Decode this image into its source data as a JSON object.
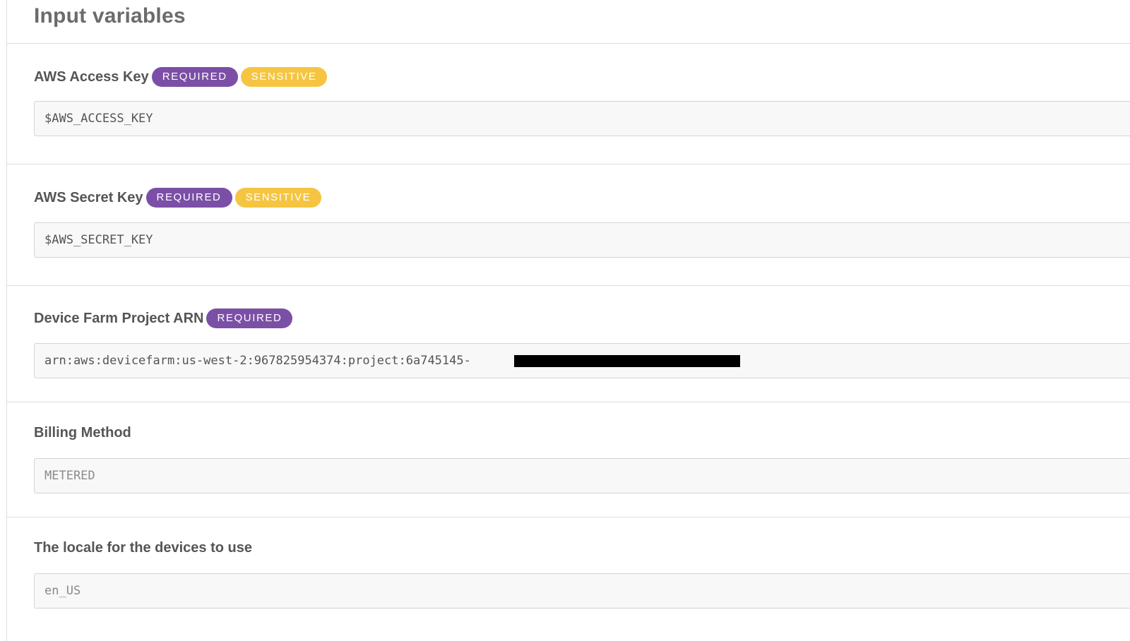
{
  "panel": {
    "title": "Input variables"
  },
  "variables": [
    {
      "label": "AWS Access Key",
      "badges": [
        "REQUIRED",
        "SENSITIVE"
      ],
      "value": "$AWS_ACCESS_KEY"
    },
    {
      "label": "AWS Secret Key",
      "badges": [
        "REQUIRED",
        "SENSITIVE"
      ],
      "value": "$AWS_SECRET_KEY"
    },
    {
      "label": "Device Farm Project ARN",
      "badges": [
        "REQUIRED"
      ],
      "value": "arn:aws:devicefarm:us-west-2:967825954374:project:6a745145-"
    },
    {
      "label": "Billing Method",
      "badges": [],
      "placeholder": "METERED"
    },
    {
      "label": "The locale for the devices to use",
      "badges": [],
      "placeholder": "en_US"
    }
  ],
  "colors": {
    "required_badge": "#7b4fa6",
    "sensitive_badge": "#f5c542"
  }
}
